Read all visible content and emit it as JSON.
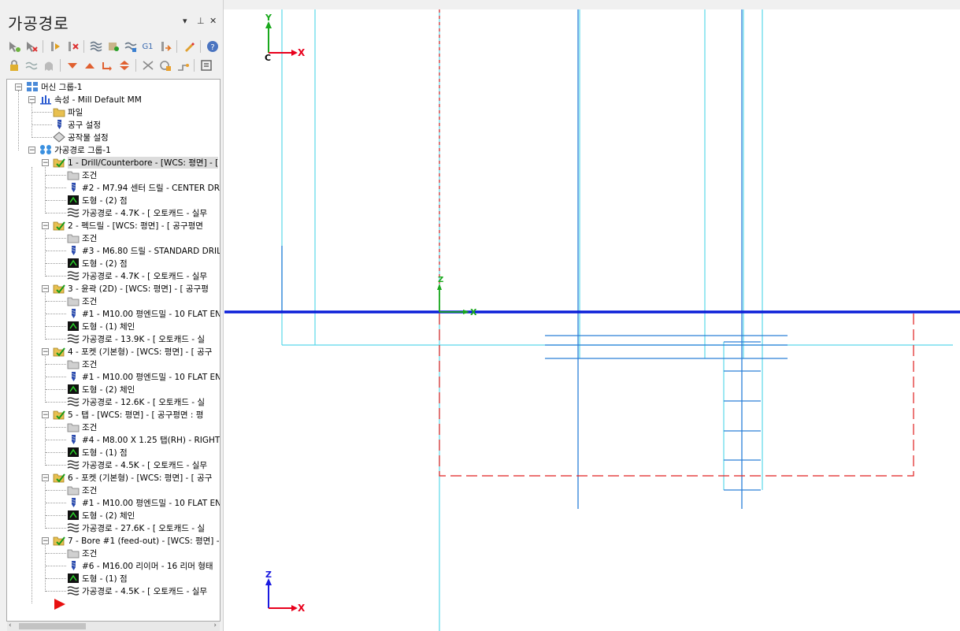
{
  "panel": {
    "title": "가공경로",
    "controls": {
      "dropdown": "▾",
      "pin": "⊥",
      "close": "✕"
    }
  },
  "toolbar": {
    "row1": [
      "select-ops-icon",
      "deselect-ops-icon",
      "regen-all-icon",
      "regen-dirty-icon",
      "backplot-icon",
      "verify-icon",
      "simulate-icon",
      "post-g1-icon",
      "high-feed-icon",
      "edit-icon",
      "help-icon"
    ],
    "row2": [
      "lock-icon",
      "toolpath-display-icon",
      "ghost-icon",
      "move-down-icon",
      "move-up-icon",
      "insert-arrow-icon",
      "expand-icon",
      "select-tool-icon",
      "toggle-display-icon",
      "posting-icon",
      "info-icon"
    ],
    "g1_label": "G1"
  },
  "tree": {
    "machine_group": "머신 그룹-1",
    "properties": "속성 - Mill Default MM",
    "files": "파일",
    "tool_settings": "공구 설정",
    "stock_setup": "공작물 설정",
    "toolpath_group": "가공경로 그룹-1",
    "operations": [
      {
        "title": "1 - Drill/Counterbore - [WCS: 평면] - [",
        "params": "조건",
        "tool": "#2 - M7.94 센터 드릴 - CENTER DR",
        "geometry": "도형 - (2) 점",
        "toolpath": "가공경로 - 4.7K - [ 오토캐드 - 실무"
      },
      {
        "title": "2 - 펙드릴 - [WCS: 평면] - [  공구평면",
        "params": "조건",
        "tool": "#3 - M6.80 드릴 - STANDARD DRIL",
        "geometry": "도형 - (2) 점",
        "toolpath": "가공경로 - 4.7K - [ 오토캐드 - 실무"
      },
      {
        "title": "3 - 윤곽 (2D) - [WCS: 평면] - [  공구평",
        "params": "조건",
        "tool": "#1 - M10.00 평엔드밀 - 10 FLAT EN",
        "geometry": "도형 - (1) 체인",
        "toolpath": "가공경로 - 13.9K - [ 오토캐드 - 실"
      },
      {
        "title": "4 - 포켓 (기본형) - [WCS: 평면] - [  공구",
        "params": "조건",
        "tool": "#1 - M10.00 평엔드밀 - 10 FLAT EN",
        "geometry": "도형 - (2) 체인",
        "toolpath": "가공경로 - 12.6K - [ 오토캐드 - 실"
      },
      {
        "title": "5 - 탭 - [WCS: 평면] - [  공구평면 : 평",
        "params": "조건",
        "tool": "#4 - M8.00 X 1.25 탭(RH) - RIGHT",
        "geometry": "도형 - (1) 점",
        "toolpath": "가공경로 - 4.5K - [ 오토캐드 - 실무"
      },
      {
        "title": "6 - 포켓 (기본형) - [WCS: 평면] - [  공구",
        "params": "조건",
        "tool": "#1 - M10.00 평엔드밀 - 10 FLAT EN",
        "geometry": "도형 - (2) 체인",
        "toolpath": "가공경로 - 27.6K - [ 오토캐드 - 실"
      },
      {
        "title": "7 - Bore #1 (feed-out) - [WCS: 평면] -",
        "params": "조건",
        "tool": "#6 - M16.00 리이머 - 16 리머 형태",
        "geometry": "도형 - (1) 점",
        "toolpath": "가공경로 - 4.5K - [ 오토캐드 - 실무"
      }
    ]
  },
  "viewport": {
    "gview_axes": {
      "y": "Y",
      "x": "X",
      "c": "C"
    },
    "origin_axes": {
      "z": "Z",
      "x": "X"
    },
    "bottom_axes": {
      "z": "Z",
      "x": "X"
    },
    "colors": {
      "axis_x": "#e8001c",
      "axis_y": "#19a81c",
      "axis_z": "#1a1ae0",
      "origin_x": "#00c000",
      "geometry": "#5ad8ea",
      "toolpath": "#2a7fd8",
      "stock": "#e02020",
      "wcs_line": "#0b1fd8"
    }
  }
}
